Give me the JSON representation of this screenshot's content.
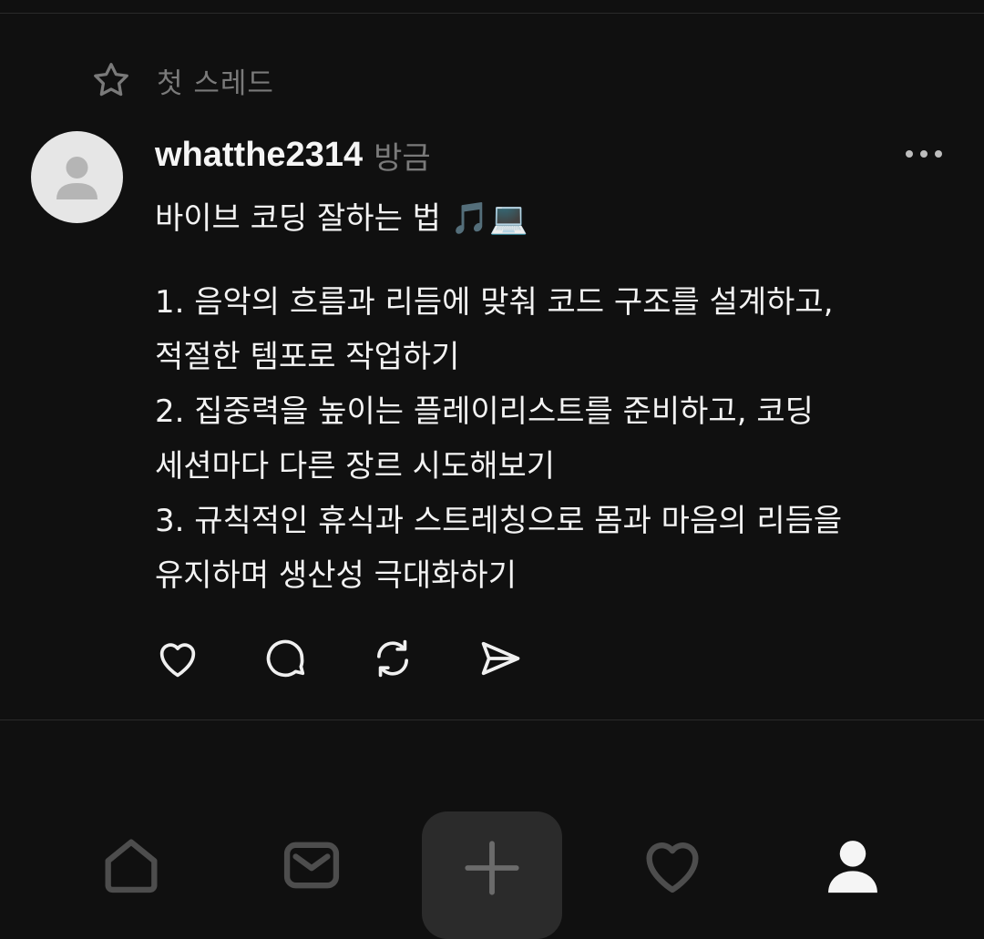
{
  "feed": {
    "section_label": "첫 스레드"
  },
  "post": {
    "username": "whatthe2314",
    "timestamp": "방금",
    "title": "바이브 코딩 잘하는 법 🎵💻",
    "body_lines": [
      "1. 음악의 흐름과 리듬에 맞춰 코드 구조를 설계하고,",
      "적절한 템포로 작업하기",
      "2. 집중력을 높이는 플레이리스트를 준비하고, 코딩",
      "세션마다 다른 장르 시도해보기",
      "3. 규칙적인 휴식과 스트레칭으로 몸과 마음의 리듬을",
      "유지하며 생산성 극대화하기"
    ],
    "actions": [
      "heart-icon",
      "comment-icon",
      "repost-icon",
      "send-icon"
    ]
  },
  "bottom_nav": {
    "items": [
      "home-icon",
      "mail-icon",
      "plus-icon",
      "heart-icon",
      "profile-icon"
    ],
    "active": "profile-icon"
  },
  "colors": {
    "background": "#101010",
    "text_primary": "#f3f3f3",
    "text_muted": "#7a7a7a",
    "compose_button": "#2b2b2b",
    "avatar_bg": "#e6e6e6"
  }
}
